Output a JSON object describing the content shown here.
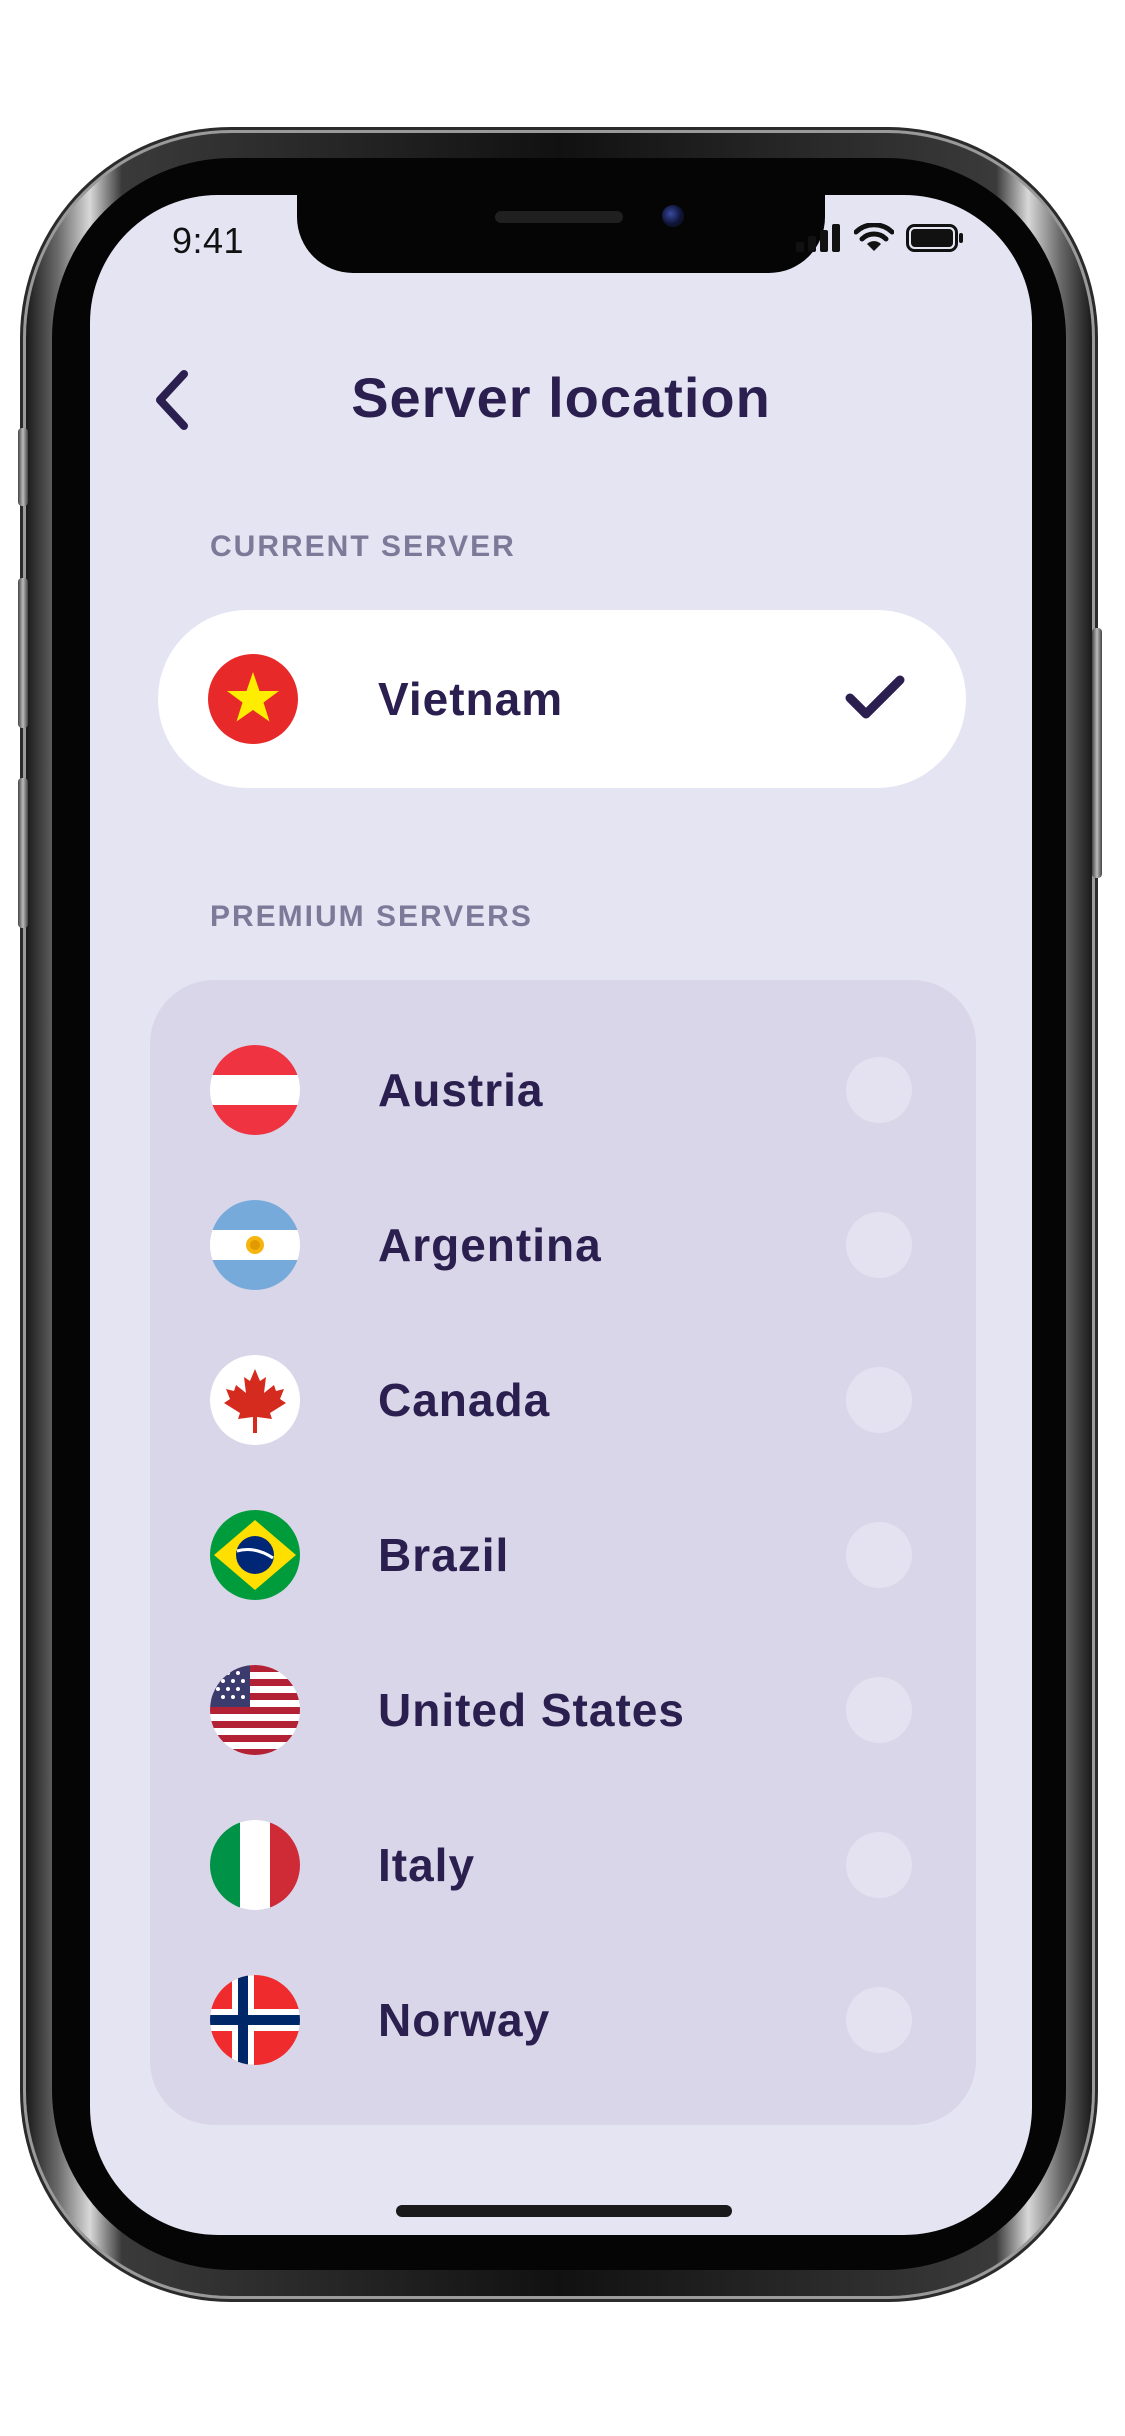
{
  "status_bar": {
    "time": "9:41"
  },
  "header": {
    "title": "Server location"
  },
  "current_section": {
    "label": "CURRENT SERVER"
  },
  "current_server": {
    "name": "Vietnam",
    "flag": "vietnam-flag",
    "selected": true
  },
  "premium_section": {
    "label": "PREMIUM SERVERS"
  },
  "premium_servers": [
    {
      "name": "Austria",
      "flag": "austria-flag",
      "selected": false
    },
    {
      "name": "Argentina",
      "flag": "argentina-flag",
      "selected": false
    },
    {
      "name": "Canada",
      "flag": "canada-flag",
      "selected": false
    },
    {
      "name": "Brazil",
      "flag": "brazil-flag",
      "selected": false
    },
    {
      "name": "United States",
      "flag": "united-states-flag",
      "selected": false
    },
    {
      "name": "Italy",
      "flag": "italy-flag",
      "selected": false
    },
    {
      "name": "Norway",
      "flag": "norway-flag",
      "selected": false
    }
  ],
  "colors": {
    "background": "#e5e4f3",
    "card": "#ffffff",
    "premium_card": "#d8d6e8",
    "text_primary": "#2a1f4e",
    "text_muted": "#7d7a99"
  }
}
